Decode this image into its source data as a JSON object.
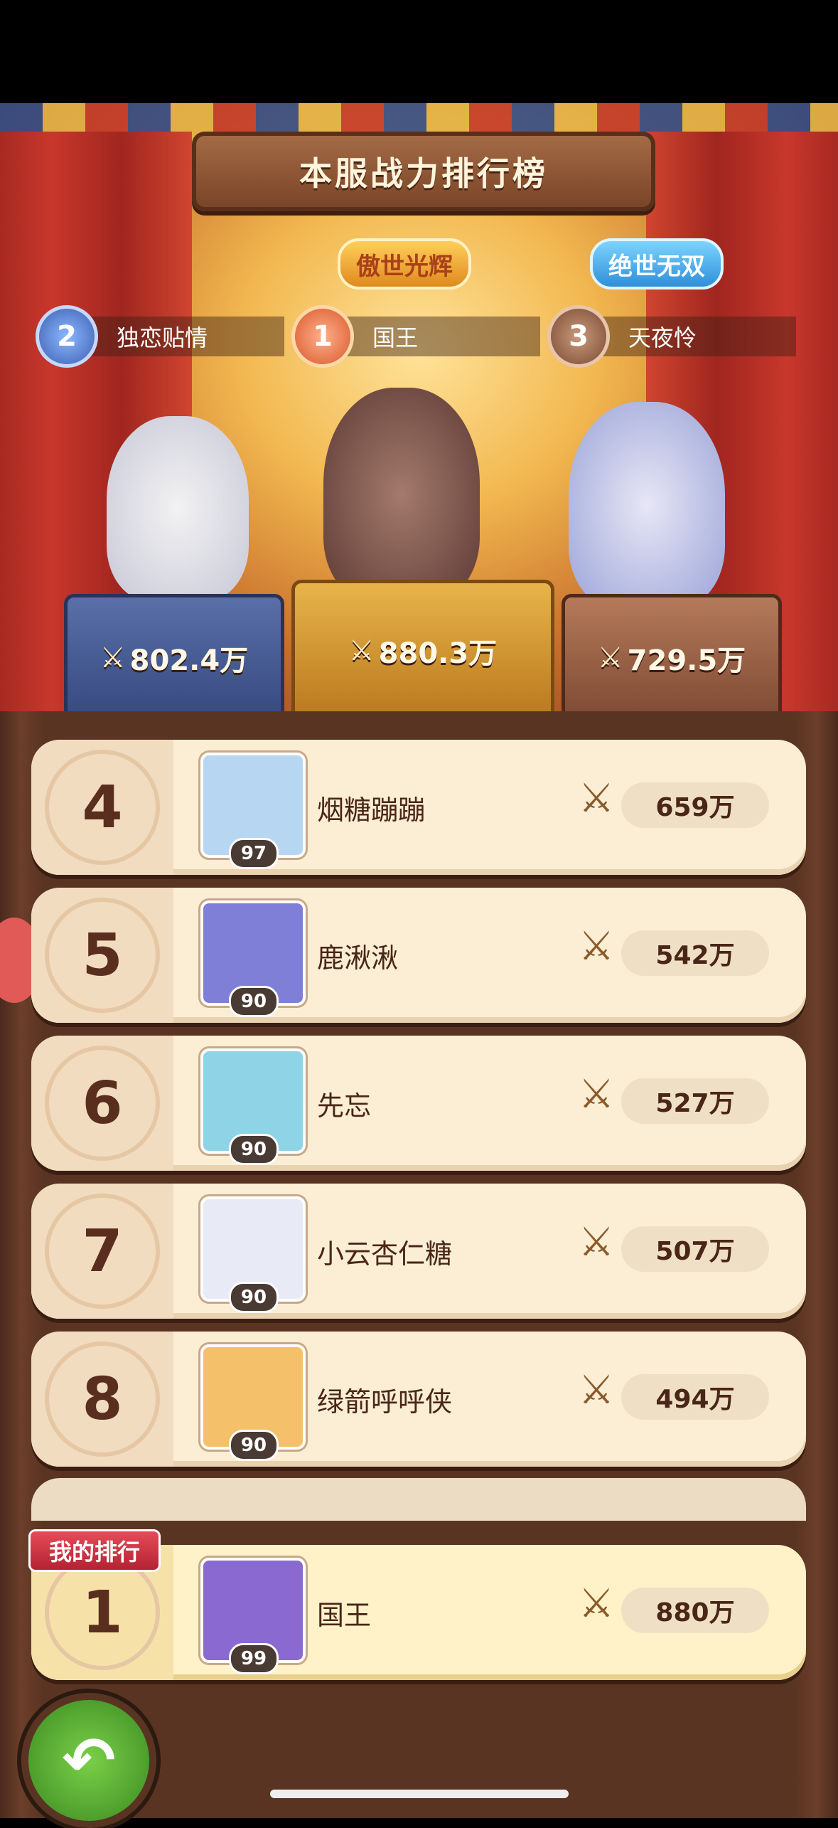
{
  "title": "本服战力排行榜",
  "badges": {
    "left": "傲世光辉",
    "right": "绝世无双"
  },
  "podium": [
    {
      "rank": "2",
      "name": "独恋贴情",
      "power": "802.4万"
    },
    {
      "rank": "1",
      "name": "国王",
      "power": "880.3万"
    },
    {
      "rank": "3",
      "name": "天夜怜",
      "power": "729.5万"
    }
  ],
  "rows": [
    {
      "rank": "4",
      "name": "烟糖蹦蹦",
      "level": "97",
      "power": "659万",
      "color": "#b7d6f2"
    },
    {
      "rank": "5",
      "name": "鹿湫湫",
      "level": "90",
      "power": "542万",
      "color": "#7f7fd8"
    },
    {
      "rank": "6",
      "name": "先忘",
      "level": "90",
      "power": "527万",
      "color": "#8fd3e6"
    },
    {
      "rank": "7",
      "name": "小云杏仁糖",
      "level": "90",
      "power": "507万",
      "color": "#e8eaf5"
    },
    {
      "rank": "8",
      "name": "绿箭呼呼侠",
      "level": "90",
      "power": "494万",
      "color": "#f4c06a"
    }
  ],
  "my_rank": {
    "label": "我的排行",
    "rank": "1",
    "name": "国王",
    "level": "99",
    "power": "880万",
    "color": "#8a6ad0"
  },
  "icons": {
    "power": "crossed-swords-icon",
    "back": "back-arrow-icon"
  }
}
